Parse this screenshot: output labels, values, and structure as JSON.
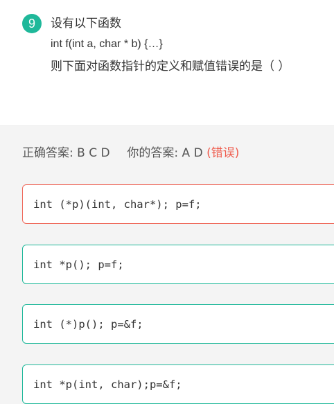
{
  "question": {
    "number": "9",
    "line1": "设有以下函数",
    "line2": "int f(int a, char * b) {…}",
    "line3": "则下面对函数指针的定义和赋值错误的是（ ）"
  },
  "answer": {
    "correct_label": "正确答案:",
    "correct_value": "B C D",
    "yours_label": "你的答案:",
    "yours_value": "A D",
    "verdict": "(错误)"
  },
  "options": [
    {
      "code": "int (*p)(int, char*); p=f;",
      "state": "wrong"
    },
    {
      "code": "int *p(); p=f;",
      "state": "normal"
    },
    {
      "code": "int (*)p(); p=&f;",
      "state": "normal"
    },
    {
      "code": "int *p(int, char);p=&f;",
      "state": "normal"
    }
  ],
  "colors": {
    "accent": "#1fb89a",
    "error": "#ef5b4c",
    "background": "#f4f4f4"
  }
}
